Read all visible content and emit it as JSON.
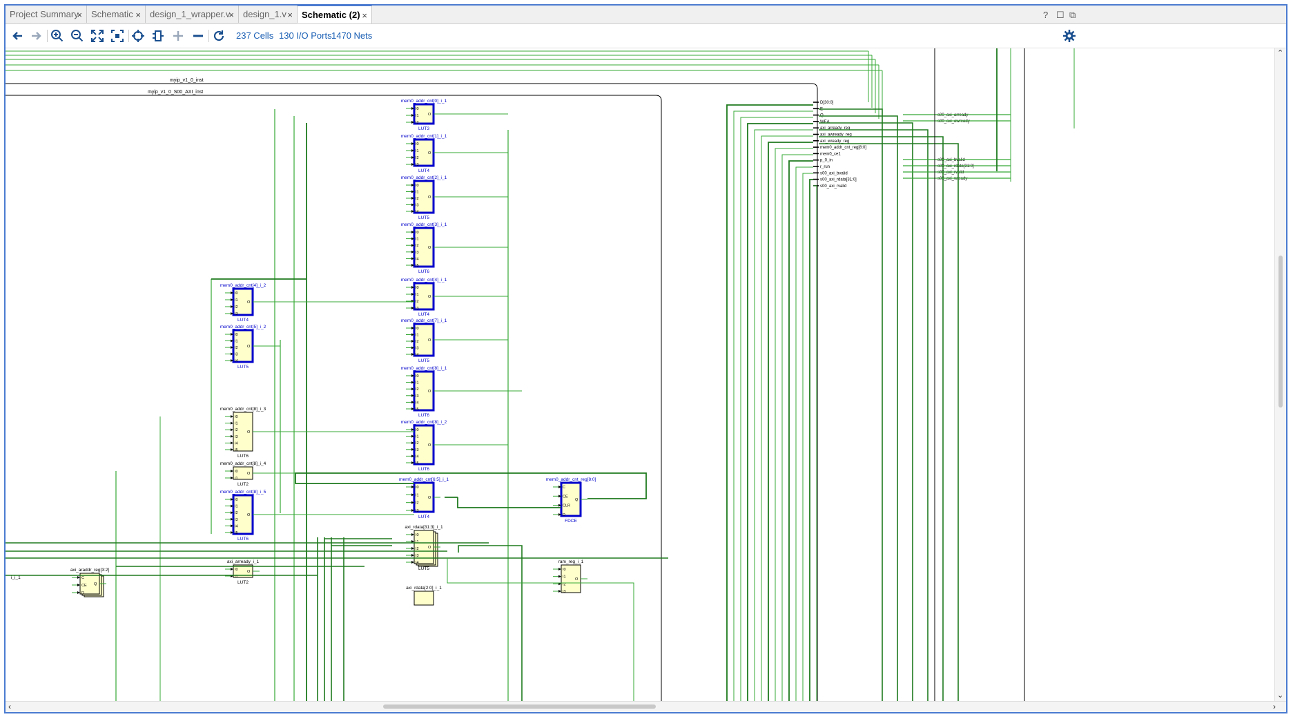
{
  "tabs": [
    {
      "label": "Project Summary"
    },
    {
      "label": "Schematic"
    },
    {
      "label": "design_1_wrapper.v"
    },
    {
      "label": "design_1.v"
    },
    {
      "label": "Schematic (2)"
    }
  ],
  "window_controls": {
    "help": "?",
    "restore": "☐",
    "float": "⧉"
  },
  "toolbar": {
    "cells": "237 Cells",
    "ports": "130 I/O Ports",
    "nets": "1470 Nets"
  },
  "hierarchy": {
    "outer": "myip_v1_0_inst",
    "inner": "myip_v1_0_S00_AXI_inst"
  },
  "luts": [
    {
      "name": "mem0_addr_cnt[0]_i_1",
      "type": "LUT3",
      "pins": [
        "I0",
        "I1",
        "I2"
      ],
      "out": "O"
    },
    {
      "name": "mem0_addr_cnt[1]_i_1",
      "type": "LUT4",
      "pins": [
        "I0",
        "I1",
        "I2",
        "I3"
      ],
      "out": "O"
    },
    {
      "name": "mem0_addr_cnt[2]_i_1",
      "type": "LUT5",
      "pins": [
        "I0",
        "I1",
        "I2",
        "I3",
        "I4"
      ],
      "out": "O"
    },
    {
      "name": "mem0_addr_cnt[3]_i_1",
      "type": "LUT6",
      "pins": [
        "I0",
        "I1",
        "I2",
        "I3",
        "I4",
        "I5"
      ],
      "out": "O"
    },
    {
      "name": "mem0_addr_cnt[4]_i_1",
      "type": "LUT4",
      "pins": [
        "I0",
        "I1",
        "I2",
        "I3"
      ],
      "out": "O"
    },
    {
      "name": "mem0_addr_cnt[7]_i_1",
      "type": "LUT5",
      "pins": [
        "I0",
        "I1",
        "I2",
        "I3",
        "I4"
      ],
      "out": "O"
    },
    {
      "name": "mem0_addr_cnt[8]_i_1",
      "type": "LUT6",
      "pins": [
        "I0",
        "I1",
        "I2",
        "I3",
        "I4",
        "I5"
      ],
      "out": "O"
    },
    {
      "name": "mem0_addr_cnt[8]_i_2",
      "type": "LUT6",
      "pins": [
        "I0",
        "I1",
        "I2",
        "I3",
        "I4",
        "I5"
      ],
      "out": "O"
    },
    {
      "name": "mem0_addr_cnt[6:5]_i_1",
      "type": "LUT4",
      "pins": [
        "I0",
        "I1",
        "I2",
        "I3"
      ],
      "out": "O"
    },
    {
      "name": "mem0_addr_cnt[4]_i_2",
      "type": "LUT4",
      "pins": [
        "I0",
        "I1",
        "I2",
        "I3"
      ],
      "out": "O"
    },
    {
      "name": "mem0_addr_cnt[5]_i_2",
      "type": "LUT5",
      "pins": [
        "I0",
        "I1",
        "I2",
        "I3",
        "I4"
      ],
      "out": "O"
    },
    {
      "name": "mem0_addr_cnt[8]_i_3",
      "type": "LUT6",
      "pins": [
        "I0",
        "I1",
        "I2",
        "I3",
        "I4",
        "I5"
      ],
      "out": "O"
    },
    {
      "name": "mem0_addr_cnt[8]_i_4",
      "type": "LUT2",
      "pins": [
        "I0",
        "I1"
      ],
      "out": "O"
    },
    {
      "name": "mem0_addr_cnt[8]_i_5",
      "type": "LUT6",
      "pins": [
        "I0",
        "I1",
        "I2",
        "I3",
        "I4",
        "I5"
      ],
      "out": "O"
    },
    {
      "name": "axi_rdata[31:3]_i_1",
      "type": "LUT5",
      "pins": [
        "I0",
        "I1",
        "I2",
        "I3",
        "I4"
      ],
      "out": "O"
    },
    {
      "name": "axi_arready_i_1",
      "type": "LUT2",
      "pins": [
        "I0",
        "I1"
      ],
      "out": "O"
    },
    {
      "name": "ram_reg_i_1",
      "type": "",
      "pins": [
        "I0",
        "I1",
        "I2",
        "I3"
      ],
      "out": "O"
    },
    {
      "name": "axi_rdata[2:0]_i_1",
      "type": "",
      "pins": [],
      "out": ""
    }
  ],
  "flops": [
    {
      "name": "mem0_addr_cnt_reg[8:0]",
      "type": "FDCE",
      "pins": [
        "C",
        "CE",
        "CLR",
        "D"
      ],
      "out": "Q"
    },
    {
      "name": "axi_araddr_reg[3:2]",
      "type": "",
      "pins": [
        "C",
        "CE",
        "D"
      ],
      "out": "Q"
    }
  ],
  "left_partial": "i_i_1",
  "big_block_pins": [
    "D[30:0]",
    "E",
    "Q",
    "WEA",
    "axi_arready_reg",
    "axi_awready_reg",
    "axi_wready_reg",
    "mem0_addr_cnt_reg[8:0]",
    "mem0_ce1",
    "p_0_in",
    "r_run",
    "s00_axi_bvalid",
    "s00_axi_rdata[31:0]",
    "s00_axi_rvalid"
  ],
  "right_ports": [
    "s00_axi_arready",
    "s00_axi_awready",
    "s00_axi_bvalid",
    "s00_axi_rdata[31:0]",
    "s00_axi_rvalid",
    "s00_axi_wready"
  ],
  "colors": {
    "wire": "#34a834",
    "bus": "#1e7a1e",
    "selected": "#0000cc",
    "cell_fill": "#ffffcc",
    "tab_accent": "#4a7bd0",
    "link": "#1a5fb4"
  }
}
